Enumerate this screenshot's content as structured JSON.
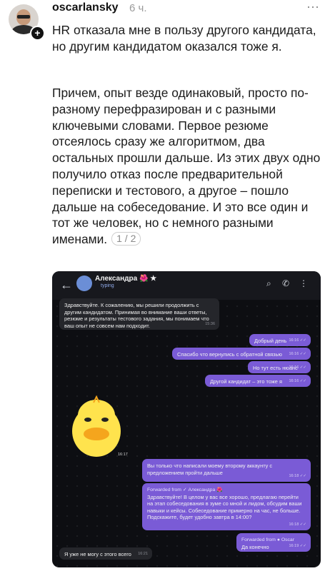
{
  "post": {
    "username": "oscarlansky",
    "time": "6 ч.",
    "more_icon": "⋯",
    "plus": "+",
    "paragraph1": "HR отказала мне в пользу другого кандидата, но другим кандидатом оказался тоже я.",
    "paragraph2": "Причем, опыт везде одинаковый, просто по-разному перефразирован и с разными ключевыми словами. Первое резюме отсеялось сразу же алгоритмом, два остальных прошли дальше. Из этих двух одно получило отказ после предварительной переписки и тестового, а другое – пошло дальше на собеседование. И это все один и тот же человек, но с немного разными именами.",
    "pager": "1 / 2"
  },
  "chat": {
    "contact_name": "Александра 🌺 ★",
    "status": "typing",
    "back_icon": "←",
    "search_icon": "⌕",
    "call_icon": "✆",
    "menu_icon": "⋮",
    "messages": [
      {
        "text": "Здравствуйте. К сожалению, мы решили продолжить с другим кандидатом. Принимая во внимание ваши ответы, резюме и результаты тестового задания, мы понимаем что ваш опыт не совсем нам подходит.",
        "time": "15:36"
      },
      {
        "text": "Добрый день",
        "time": "16:16 ✓✓"
      },
      {
        "text": "Спасибо что вернулись с обратной связью",
        "time": "16:16 ✓✓"
      },
      {
        "text": "Но тут есть нюанс",
        "time": "16:16 ✓✓"
      },
      {
        "text": "Другой кандидат – это тоже я",
        "time": "16:16 ✓✓"
      },
      {
        "text": "",
        "time": "16:17"
      },
      {
        "text": "Вы только что написали моему второму аккаунту с предложением пройти дальше",
        "time": "16:18 ✓✓"
      },
      {
        "forward": "Forwarded from ✓ Александра 🌺",
        "text": "Здравствуйте! В целом у вас все хорошо, предлагаю перейти на этап собеседования в зуме со мной и лидом, обсудим ваши навыки и кейсы. Собеседование примерно на час, не больше. Подскажите, будет удобно завтра в 14:00?",
        "time": "16:18 ✓✓"
      },
      {
        "forward": "Forwarded from ● Oscar",
        "text": "Да конечно",
        "time": "16:19 ✓✓"
      },
      {
        "text": "Я уже не могу с этого всего",
        "time": "16:21"
      }
    ]
  }
}
